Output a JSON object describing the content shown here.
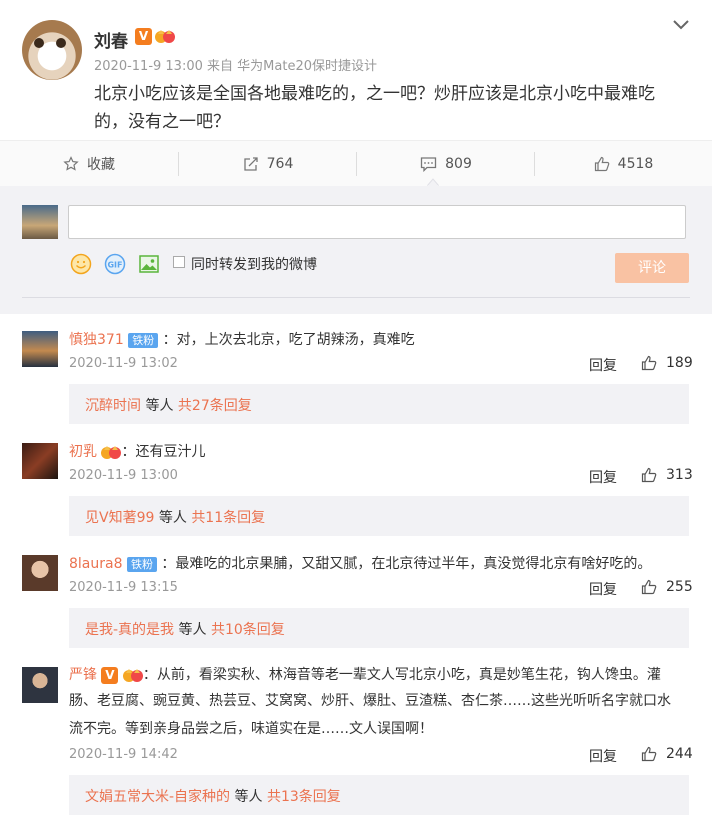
{
  "post": {
    "author": "刘春",
    "v_badge": "V",
    "timestamp": "2020-11-9 13:00",
    "source_prefix": "来自",
    "source": "华为Mate20保时捷设计",
    "text": "北京小吃应该是全国各地最难吃的，之一吧？炒肝应该是北京小吃中最难吃的，没有之一吧？"
  },
  "actions": {
    "favorite": "收藏",
    "repost": "764",
    "comments": "809",
    "likes": "4518"
  },
  "compose": {
    "checkbox_label": "同时转发到我的微博",
    "submit_label": "评论"
  },
  "comments": [
    {
      "name": "慎独371",
      "badge": "铁粉",
      "text": "：对，上次去北京，吃了胡辣汤，真难吃",
      "time": "2020-11-9 13:02",
      "reply": "回复",
      "likes": "189",
      "sub_user": "沉醉时间",
      "sub_mid": " 等人 ",
      "sub_count": "共27条回复"
    },
    {
      "name": "初乳",
      "text": "：还有豆汁儿",
      "time": "2020-11-9 13:00",
      "reply": "回复",
      "likes": "313",
      "sub_user": "见V知著99",
      "sub_mid": " 等人 ",
      "sub_count": "共11条回复"
    },
    {
      "name": "8laura8",
      "badge": "铁粉",
      "text": "：最难吃的北京果脯，又甜又腻，在北京待过半年，真没觉得北京有啥好吃的。",
      "time": "2020-11-9 13:15",
      "reply": "回复",
      "likes": "255",
      "sub_user": "是我-真的是我",
      "sub_mid": " 等人 ",
      "sub_count": "共10条回复"
    },
    {
      "name": "严锋",
      "v_badge": "V",
      "text_line1": "：从前，看梁实秋、林海音等老一辈文人写北京小吃，真是妙笔生花，钩人馋虫。灌",
      "text_line2": "肠、老豆腐、豌豆黄、热芸豆、艾窝窝、炒肝、爆肚、豆渣糕、杏仁茶……这些光听听名字就口水",
      "text_line3": "流不完。等到亲身品尝之后，味道实在是……文人误国啊！",
      "time": "2020-11-9 14:42",
      "reply": "回复",
      "likes": "244",
      "sub_user": "文娟五常大米-自家种的",
      "sub_mid": " 等人 ",
      "sub_count": "共13条回复"
    }
  ],
  "colors": {
    "accent": "#eb7350",
    "vip": "#f47d1f",
    "submit": "#f9c2a3"
  }
}
